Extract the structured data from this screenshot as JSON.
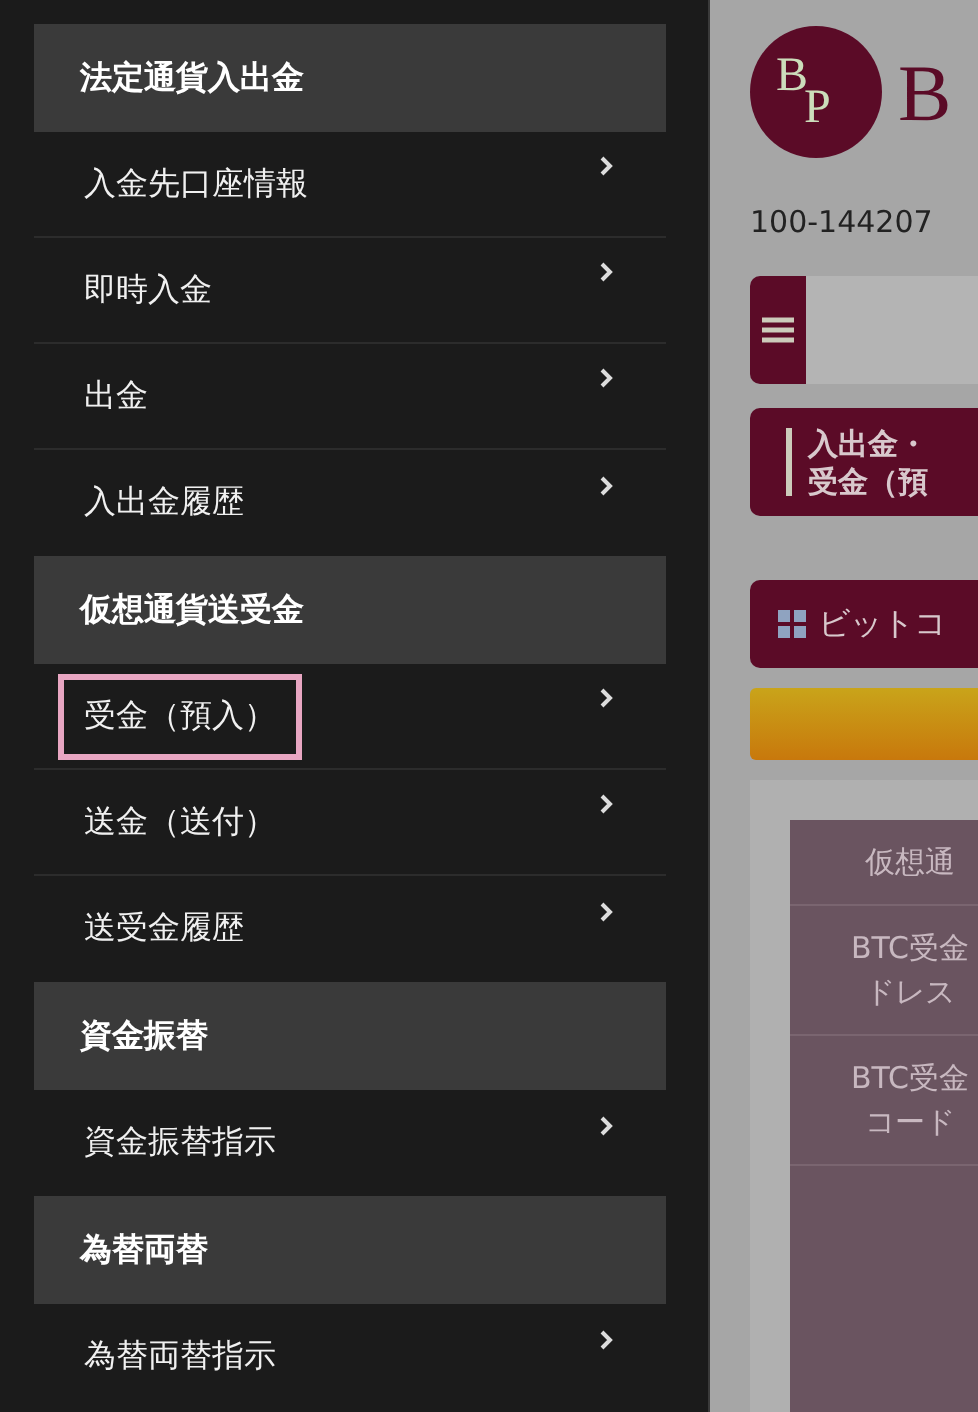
{
  "sidebar": {
    "sections": [
      {
        "title": "法定通貨入出金",
        "items": [
          {
            "label": "入金先口座情報",
            "selected": false
          },
          {
            "label": "即時入金",
            "selected": false
          },
          {
            "label": "出金",
            "selected": false
          },
          {
            "label": "入出金履歴",
            "selected": false
          }
        ]
      },
      {
        "title": "仮想通貨送受金",
        "items": [
          {
            "label": "受金（預入）",
            "selected": true
          },
          {
            "label": "送金（送付）",
            "selected": false
          },
          {
            "label": "送受金履歴",
            "selected": false
          }
        ]
      },
      {
        "title": "資金振替",
        "items": [
          {
            "label": "資金振替指示",
            "selected": false
          }
        ]
      },
      {
        "title": "為替両替",
        "items": [
          {
            "label": "為替両替指示",
            "selected": false
          }
        ]
      }
    ]
  },
  "page": {
    "logo": {
      "monogram_top": "B",
      "monogram_bottom": "P",
      "wordmark": "B"
    },
    "account_number": "100-144207",
    "breadcrumb": [
      "入出金・",
      "受金（預"
    ],
    "coin_button": "ビットコ",
    "table": {
      "rows": [
        [
          "仮想通"
        ],
        [
          "BTC受金",
          "ドレス"
        ],
        [
          "BTC受金",
          "コード"
        ]
      ]
    }
  }
}
